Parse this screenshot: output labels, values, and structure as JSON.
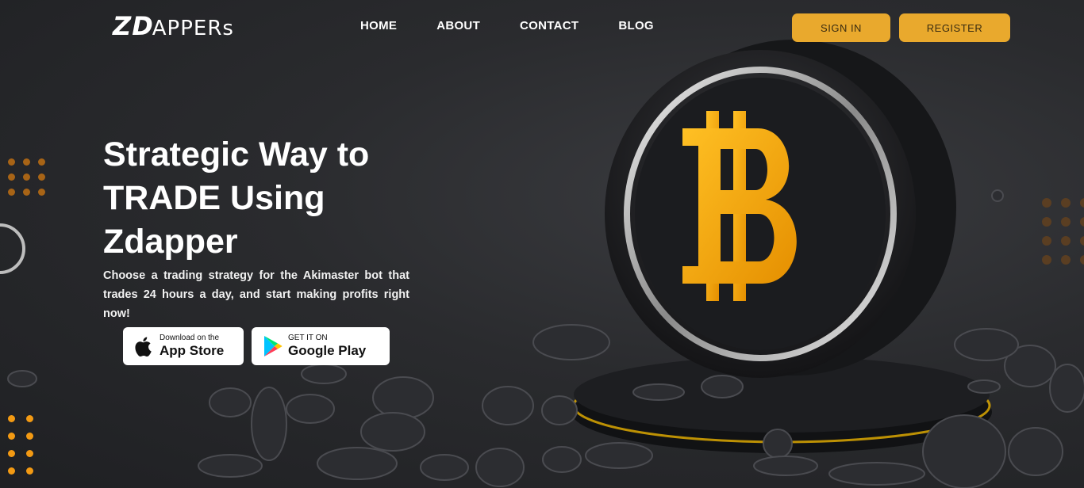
{
  "brand": {
    "logo_mark": "ZD",
    "logo_text": "APPERs"
  },
  "nav": {
    "items": [
      "HOME",
      "ABOUT",
      "CONTACT",
      "BLOG"
    ]
  },
  "auth": {
    "signin": "SIGN IN",
    "register": "REGISTER"
  },
  "hero": {
    "title": "Strategic Way to TRADE Using Zdapper",
    "subtitle": "Choose a trading strategy for the Akimaster bot that trades 24 hours a day, and start making profits right now!"
  },
  "stores": {
    "apple_small": "Download on the",
    "apple_big": "App Store",
    "google_small": "GET IT ON",
    "google_big": "Google Play"
  },
  "colors": {
    "accent": "#e9a92d",
    "bitcoin": "#f5a80a",
    "background": "#2a2b2e"
  },
  "icons": [
    "apple-icon",
    "google-play-icon",
    "bitcoin-coin-icon"
  ]
}
